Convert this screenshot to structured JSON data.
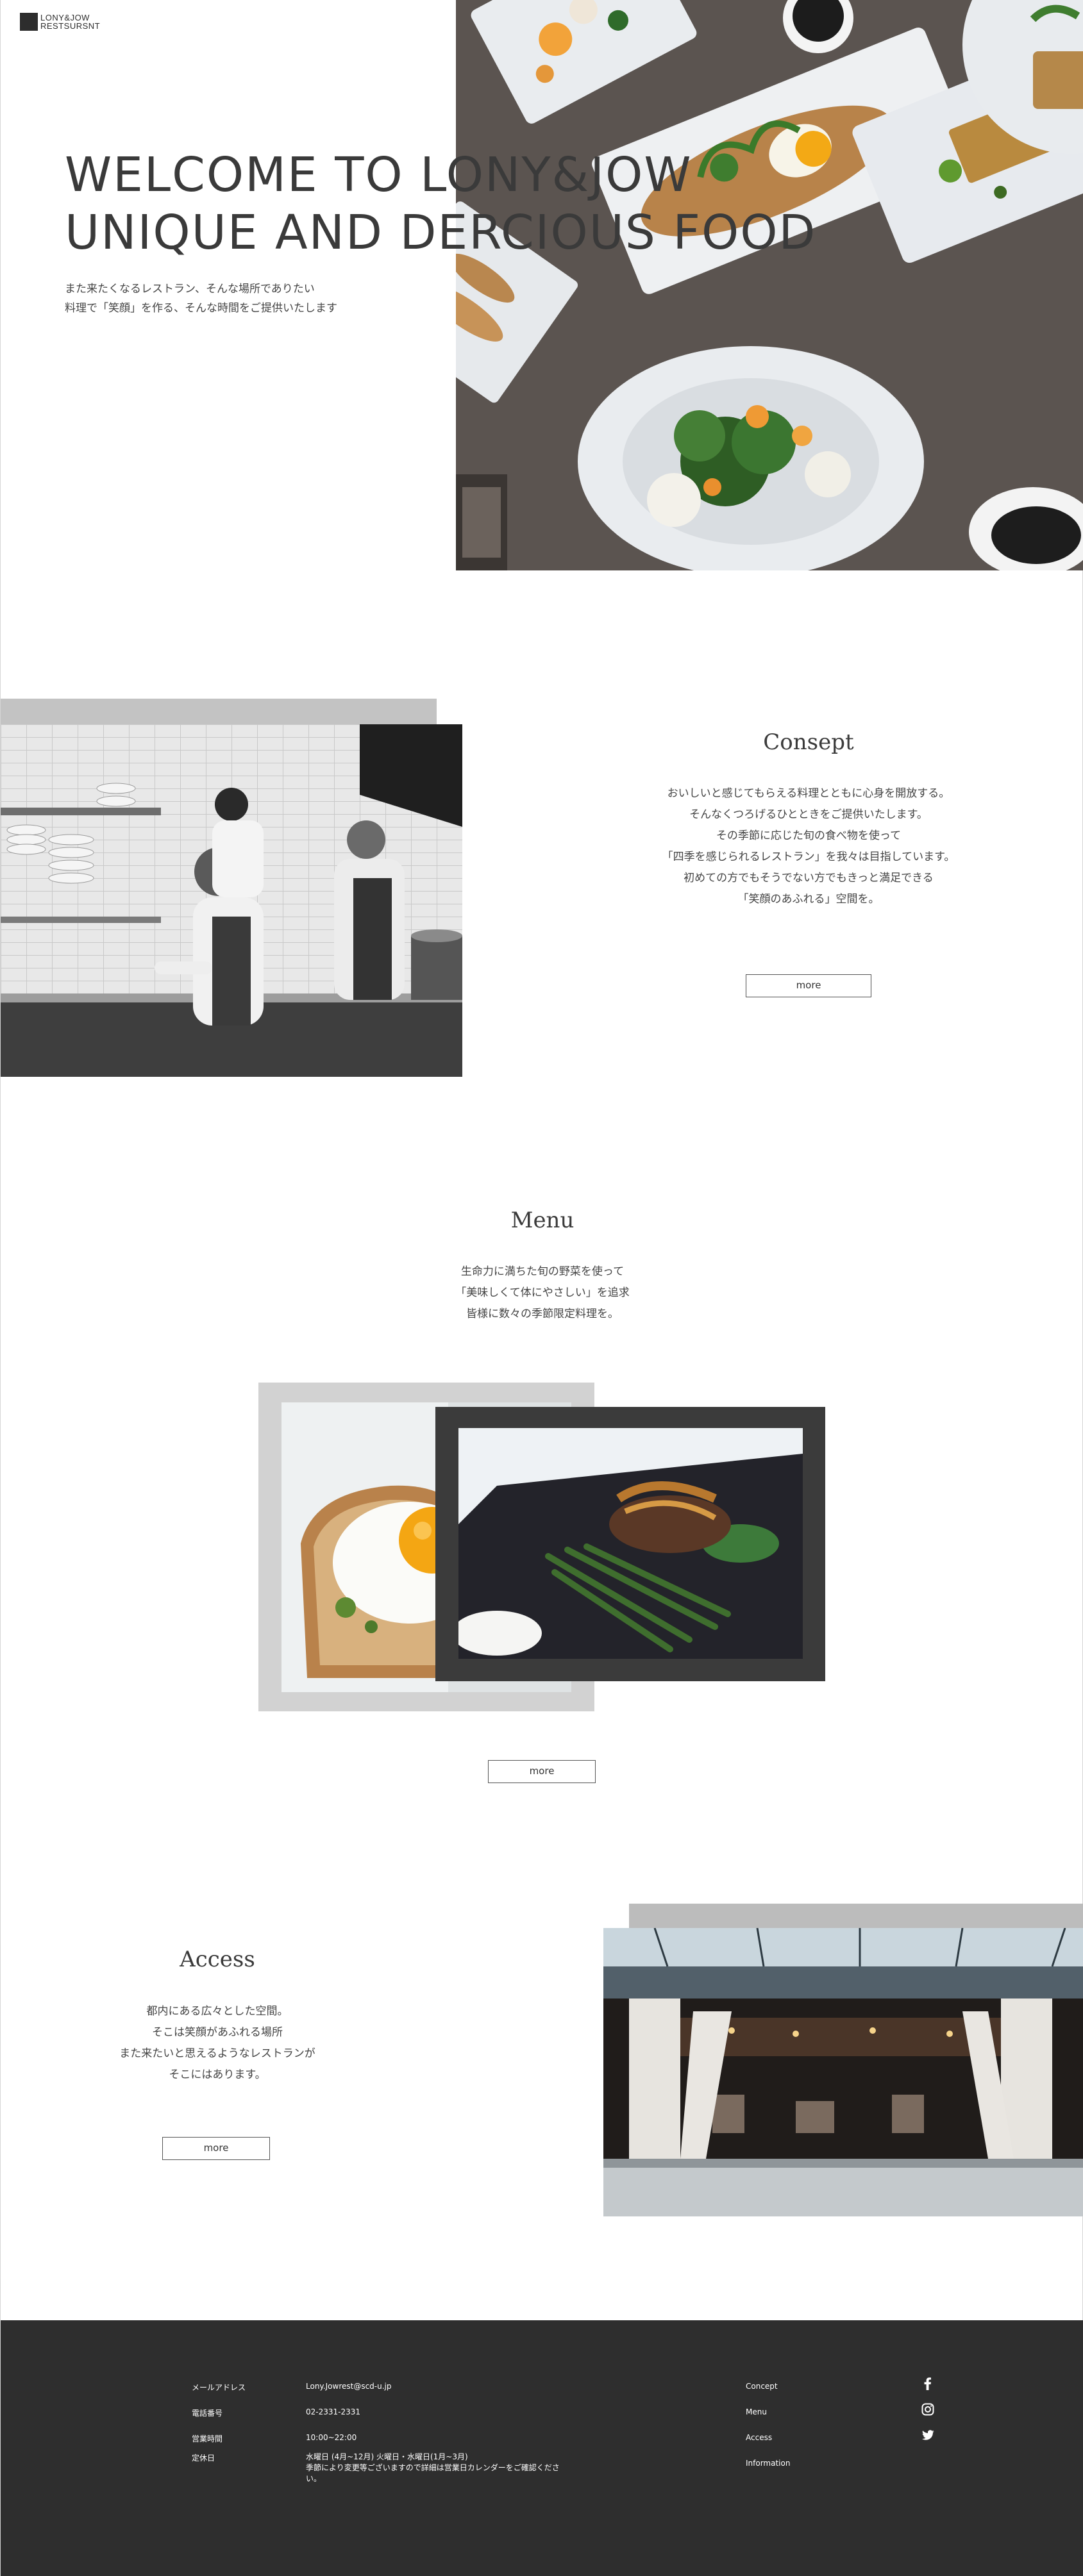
{
  "header": {
    "logo_line1": "LONY&JOW",
    "logo_line2": "RESTSURSNT"
  },
  "hero": {
    "title_line1": "WELCOME TO LONY&JOW",
    "title_line2": "UNIQUE AND DERCIOUS FOOD",
    "sub_line1": "また来たくなるレストラン、そんな場所でありたい",
    "sub_line2": "料理で「笑顔」を作る、そんな時間をご提供いたします"
  },
  "concept": {
    "title": "Consept",
    "lines": [
      "おいしいと感じてもらえる料理とともに心身を開放する。",
      "そんなくつろげるひとときをご提供いたします。",
      "その季節に応じた旬の食べ物を使って",
      "「四季を感じられるレストラン」を我々は目指しています。",
      "初めての方でもそうでない方でもきっと満足できる",
      "「笑顔のあふれる」空間を。"
    ],
    "more": "more"
  },
  "menu": {
    "title": "Menu",
    "lines": [
      "生命力に満ちた旬の野菜を使って",
      "「美味しくて体にやさしい」を追求",
      "皆様に数々の季節限定料理を。"
    ],
    "more": "more"
  },
  "access": {
    "title": "Access",
    "lines": [
      "都内にある広々とした空間。",
      "そこは笑顔があふれる場所",
      "また来たいと思えるようなレストランが",
      "そこにはあります。"
    ],
    "more": "more"
  },
  "footer": {
    "info": [
      {
        "label": "メールアドレス",
        "value": "Lony.Jowrest@scd-u.jp"
      },
      {
        "label": "電話番号",
        "value": "02-2331-2331"
      },
      {
        "label": "営業時間",
        "value": "10:00~22:00"
      },
      {
        "label": "定休日",
        "value": "水曜日 (4月~12月) 火曜日・水曜日(1月~3月)"
      }
    ],
    "holiday_note_line1": "季節により変更等ございますので詳細は営業日カレンダーをご確認くださ",
    "holiday_note_line2": "い。",
    "nav": [
      "Concept",
      "Menu",
      "Access",
      "Information"
    ],
    "social_icons": [
      "facebook-icon",
      "instagram-icon",
      "twitter-icon"
    ]
  },
  "colors": {
    "footer_bg": "#2e2e2e",
    "accent_gray": "#c3c3c3",
    "dark_frame": "#3b3b3b"
  }
}
